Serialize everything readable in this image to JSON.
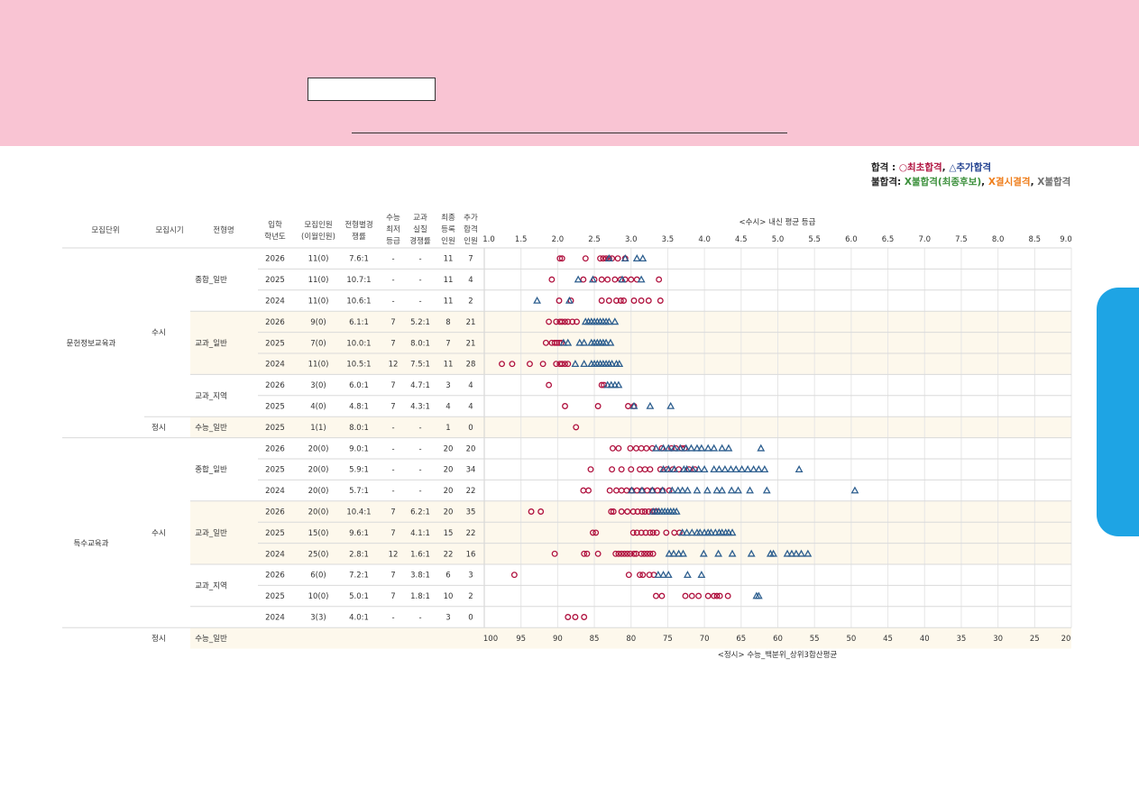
{
  "legend": {
    "pass_label": "합격",
    "pass_colon": " : ",
    "first_pass": "○최초합격",
    "comma1": ", ",
    "additional_pass": "△추가합격",
    "fail_label": "불합격:",
    "fail_waitlist": "X불합격(최종후보)",
    "comma2": ", ",
    "absent": "X결시결격",
    "comma3": ", ",
    "fail": "X불합격"
  },
  "colors": {
    "first_pass": "#b0123f",
    "additional_pass": "#2e5f8f",
    "fail_waitlist": "#3a8f3a",
    "absent": "#ef7d1a",
    "fail": "#707070",
    "banner": "#f9c4d3",
    "side_tab": "#1ea4e4",
    "band": "#fdf8ec"
  },
  "table": {
    "headers": [
      {
        "key": "unit",
        "lines": [
          "모집단위"
        ]
      },
      {
        "key": "period",
        "lines": [
          "모집시기"
        ]
      },
      {
        "key": "type",
        "lines": [
          "전형명"
        ]
      },
      {
        "key": "year",
        "lines": [
          "입학",
          "학년도"
        ]
      },
      {
        "key": "quota",
        "lines": [
          "모집인원",
          "(이월인원)"
        ]
      },
      {
        "key": "ratio",
        "lines": [
          "전형별경",
          "쟁률"
        ]
      },
      {
        "key": "min",
        "lines": [
          "수능",
          "최저",
          "등급"
        ]
      },
      {
        "key": "real",
        "lines": [
          "교과",
          "실질",
          "경쟁률"
        ]
      },
      {
        "key": "reg",
        "lines": [
          "최종",
          "등록",
          "인원"
        ]
      },
      {
        "key": "add",
        "lines": [
          "추가",
          "합격",
          "인원"
        ]
      }
    ],
    "departments": [
      {
        "name": "문헌정보교육과",
        "rows": [
          0,
          8
        ]
      },
      {
        "name": "특수교육과",
        "rows": [
          9,
          18
        ]
      }
    ],
    "periods": [
      {
        "name": "수시",
        "rows": [
          0,
          7
        ]
      },
      {
        "name": "정시",
        "rows": [
          8,
          8
        ]
      },
      {
        "name": "수시",
        "rows": [
          9,
          17
        ]
      },
      {
        "name": "정시",
        "rows": [
          18,
          18
        ]
      }
    ],
    "types": [
      {
        "name": "종합_일반",
        "rows": [
          0,
          2
        ]
      },
      {
        "name": "교과_일반",
        "rows": [
          3,
          5
        ]
      },
      {
        "name": "교과_지역",
        "rows": [
          6,
          7
        ]
      },
      {
        "name": "수능_일반",
        "rows": [
          8,
          8
        ]
      },
      {
        "name": "종합_일반",
        "rows": [
          9,
          11
        ]
      },
      {
        "name": "교과_일반",
        "rows": [
          12,
          14
        ]
      },
      {
        "name": "교과_지역",
        "rows": [
          15,
          16
        ]
      },
      {
        "name": "수능_일반",
        "rows": [
          18,
          18
        ]
      }
    ],
    "rows": [
      {
        "year": "2026",
        "quota": "11(0)",
        "ratio": "7.6:1",
        "min": "-",
        "real": "-",
        "reg": "11",
        "add": "7"
      },
      {
        "year": "2025",
        "quota": "11(0)",
        "ratio": "10.7:1",
        "min": "-",
        "real": "-",
        "reg": "11",
        "add": "4"
      },
      {
        "year": "2024",
        "quota": "11(0)",
        "ratio": "10.6:1",
        "min": "-",
        "real": "-",
        "reg": "11",
        "add": "2"
      },
      {
        "year": "2026",
        "quota": "9(0)",
        "ratio": "6.1:1",
        "min": "7",
        "real": "5.2:1",
        "reg": "8",
        "add": "21"
      },
      {
        "year": "2025",
        "quota": "7(0)",
        "ratio": "10.0:1",
        "min": "7",
        "real": "8.0:1",
        "reg": "7",
        "add": "21"
      },
      {
        "year": "2024",
        "quota": "11(0)",
        "ratio": "10.5:1",
        "min": "12",
        "real": "7.5:1",
        "reg": "11",
        "add": "28"
      },
      {
        "year": "2026",
        "quota": "3(0)",
        "ratio": "6.0:1",
        "min": "7",
        "real": "4.7:1",
        "reg": "3",
        "add": "4"
      },
      {
        "year": "2025",
        "quota": "4(0)",
        "ratio": "4.8:1",
        "min": "7",
        "real": "4.3:1",
        "reg": "4",
        "add": "4"
      },
      {
        "year": "2025",
        "quota": "1(1)",
        "ratio": "8.0:1",
        "min": "-",
        "real": "-",
        "reg": "1",
        "add": "0"
      },
      {
        "year": "2026",
        "quota": "20(0)",
        "ratio": "9.0:1",
        "min": "-",
        "real": "-",
        "reg": "20",
        "add": "20"
      },
      {
        "year": "2025",
        "quota": "20(0)",
        "ratio": "5.9:1",
        "min": "-",
        "real": "-",
        "reg": "20",
        "add": "34"
      },
      {
        "year": "2024",
        "quota": "20(0)",
        "ratio": "5.7:1",
        "min": "-",
        "real": "-",
        "reg": "20",
        "add": "22"
      },
      {
        "year": "2026",
        "quota": "20(0)",
        "ratio": "10.4:1",
        "min": "7",
        "real": "6.2:1",
        "reg": "20",
        "add": "35"
      },
      {
        "year": "2025",
        "quota": "15(0)",
        "ratio": "9.6:1",
        "min": "7",
        "real": "4.1:1",
        "reg": "15",
        "add": "22"
      },
      {
        "year": "2024",
        "quota": "25(0)",
        "ratio": "2.8:1",
        "min": "12",
        "real": "1.6:1",
        "reg": "22",
        "add": "16"
      },
      {
        "year": "2026",
        "quota": "6(0)",
        "ratio": "7.2:1",
        "min": "7",
        "real": "3.8:1",
        "reg": "6",
        "add": "3"
      },
      {
        "year": "2025",
        "quota": "10(0)",
        "ratio": "5.0:1",
        "min": "7",
        "real": "1.8:1",
        "reg": "10",
        "add": "2"
      },
      {
        "year": "2024",
        "quota": "3(3)",
        "ratio": "4.0:1",
        "min": "-",
        "real": "-",
        "reg": "3",
        "add": "0"
      }
    ]
  },
  "chart_data": {
    "type": "scatter",
    "title": "<수시> 내신 평균 등급",
    "xlabel_bottom": "<정시> 수능_백분위_상위3합산평균",
    "top_axis": {
      "range": [
        1.0,
        9.0
      ],
      "ticks": [
        "1.0",
        "1.5",
        "2.0",
        "2.5",
        "3.0",
        "3.5",
        "4.0",
        "4.5",
        "5.0",
        "5.5",
        "6.0",
        "6.5",
        "7.0",
        "7.5",
        "8.0",
        "8.5",
        "9.0"
      ]
    },
    "bottom_axis": {
      "range": [
        100,
        20
      ],
      "ticks": [
        "100",
        "95",
        "90",
        "85",
        "80",
        "75",
        "70",
        "65",
        "60",
        "55",
        "50",
        "45",
        "40",
        "35",
        "30",
        "25",
        "20"
      ]
    },
    "grid": true,
    "series_legend": [
      "○최초합격",
      "△추가합격"
    ],
    "rows": [
      {
        "scale": "grade",
        "first": [
          2.03,
          2.06,
          2.38,
          2.58,
          2.62,
          2.66,
          2.7,
          2.74,
          2.82,
          2.92
        ],
        "additional": [
          2.7,
          2.92,
          3.08,
          3.16
        ]
      },
      {
        "scale": "grade",
        "first": [
          1.92,
          2.35,
          2.5,
          2.6,
          2.68,
          2.78,
          2.86,
          2.92,
          3.0,
          3.08,
          3.38
        ],
        "additional": [
          2.28,
          2.48,
          2.88,
          3.14
        ]
      },
      {
        "scale": "grade",
        "first": [
          2.02,
          2.18,
          2.6,
          2.7,
          2.8,
          2.86,
          2.9,
          3.04,
          3.14,
          3.24,
          3.4
        ],
        "additional": [
          1.72,
          2.16
        ]
      },
      {
        "scale": "grade",
        "first": [
          1.88,
          1.98,
          2.03,
          2.06,
          2.1,
          2.14,
          2.2,
          2.26
        ],
        "additional": [
          2.38,
          2.42,
          2.46,
          2.5,
          2.54,
          2.58,
          2.62,
          2.66,
          2.7,
          2.78
        ]
      },
      {
        "scale": "grade",
        "first": [
          1.84,
          1.92,
          1.96,
          1.99,
          2.02,
          2.05
        ],
        "additional": [
          2.08,
          2.14,
          2.3,
          2.36,
          2.46,
          2.5,
          2.54,
          2.58,
          2.62,
          2.66,
          2.72
        ]
      },
      {
        "scale": "grade",
        "first": [
          1.24,
          1.38,
          1.62,
          1.8,
          1.98,
          2.03,
          2.06,
          2.1,
          2.14
        ],
        "additional": [
          2.24,
          2.36,
          2.46,
          2.5,
          2.54,
          2.58,
          2.62,
          2.66,
          2.7,
          2.74,
          2.8,
          2.84
        ]
      },
      {
        "scale": "grade",
        "first": [
          1.88,
          2.6,
          2.63
        ],
        "additional": [
          2.68,
          2.73,
          2.78,
          2.83
        ]
      },
      {
        "scale": "grade",
        "first": [
          2.1,
          2.55,
          2.96,
          3.04
        ],
        "additional": [
          3.04,
          3.26,
          3.54
        ]
      },
      {
        "scale": "percentile",
        "first": [
          87.5
        ],
        "additional": []
      },
      {
        "scale": "percentile",
        "first": [
          82.5,
          81.7,
          80.1,
          79.3,
          78.6,
          77.9,
          77.1,
          75.8,
          74.5,
          73.9,
          73.1,
          72.7
        ],
        "additional": [
          76.6,
          75.6,
          74.9,
          74.1,
          73.3,
          72.5,
          71.8,
          71.0,
          70.4,
          69.5,
          68.7,
          67.6,
          66.7,
          62.3
        ]
      },
      {
        "scale": "percentile",
        "first": [
          85.5,
          82.6,
          81.3,
          80.0,
          78.8,
          78.1,
          77.4,
          76.0,
          75.1,
          74.3,
          73.5,
          72.1,
          71.3
        ],
        "additional": [
          75.6,
          74.9,
          74.1,
          72.8,
          72.4,
          71.6,
          70.8,
          70.0,
          68.7,
          68.0,
          67.2,
          66.4,
          65.7,
          64.9,
          64.1,
          63.3,
          62.6,
          61.8,
          57.1
        ]
      },
      {
        "scale": "percentile",
        "first": [
          86.5,
          85.8,
          82.9,
          82.0,
          81.3,
          80.6,
          79.9,
          79.2,
          78.5,
          77.8,
          77.1,
          76.4,
          75.7,
          74.8
        ],
        "additional": [
          79.9,
          78.5,
          77.1,
          75.7,
          74.4,
          73.6,
          73.0,
          72.3,
          71.0,
          69.6,
          68.3,
          67.6,
          66.3,
          65.4,
          63.8,
          61.5,
          49.5
        ]
      },
      {
        "scale": "percentile",
        "first": [
          93.6,
          92.3,
          82.7,
          82.4,
          81.3,
          80.5,
          79.7,
          79.1,
          78.5,
          78.1,
          77.6,
          77.1,
          76.8,
          76.4
        ],
        "additional": [
          77.0,
          76.6,
          76.2,
          75.8,
          75.4,
          75.0,
          74.6,
          74.2,
          73.8
        ]
      },
      {
        "scale": "percentile",
        "first": [
          85.2,
          84.8,
          79.7,
          79.2,
          78.6,
          78.0,
          77.4,
          77.0,
          76.5,
          75.2,
          74.1,
          73.4
        ],
        "additional": [
          73.0,
          72.4,
          71.7,
          71.0,
          70.6,
          70.0,
          69.5,
          69.1,
          68.5,
          68.0,
          67.6,
          67.1,
          66.7,
          66.2
        ]
      },
      {
        "scale": "percentile",
        "first": [
          90.4,
          86.4,
          86.0,
          84.5,
          82.1,
          81.7,
          81.3,
          80.9,
          80.5,
          80.1,
          79.6,
          79.3,
          78.6,
          78.2,
          77.8,
          77.4,
          77.0
        ],
        "additional": [
          74.8,
          74.2,
          73.5,
          72.9,
          70.1,
          68.1,
          66.2,
          63.6,
          61.0,
          60.6,
          58.7,
          58.1,
          57.5,
          56.8,
          55.9
        ]
      },
      {
        "scale": "percentile",
        "first": [
          95.9,
          80.3,
          78.8,
          78.4,
          77.5,
          76.9
        ],
        "additional": [
          76.3,
          75.6,
          74.9,
          72.3,
          70.4
        ]
      },
      {
        "scale": "percentile",
        "first": [
          76.6,
          75.8,
          72.6,
          71.7,
          70.8,
          69.5,
          68.7,
          68.3,
          67.9,
          66.8
        ],
        "additional": [
          62.9,
          62.6
        ]
      },
      {
        "scale": "percentile",
        "first": [
          88.6,
          87.6,
          86.4
        ],
        "additional": []
      }
    ]
  }
}
